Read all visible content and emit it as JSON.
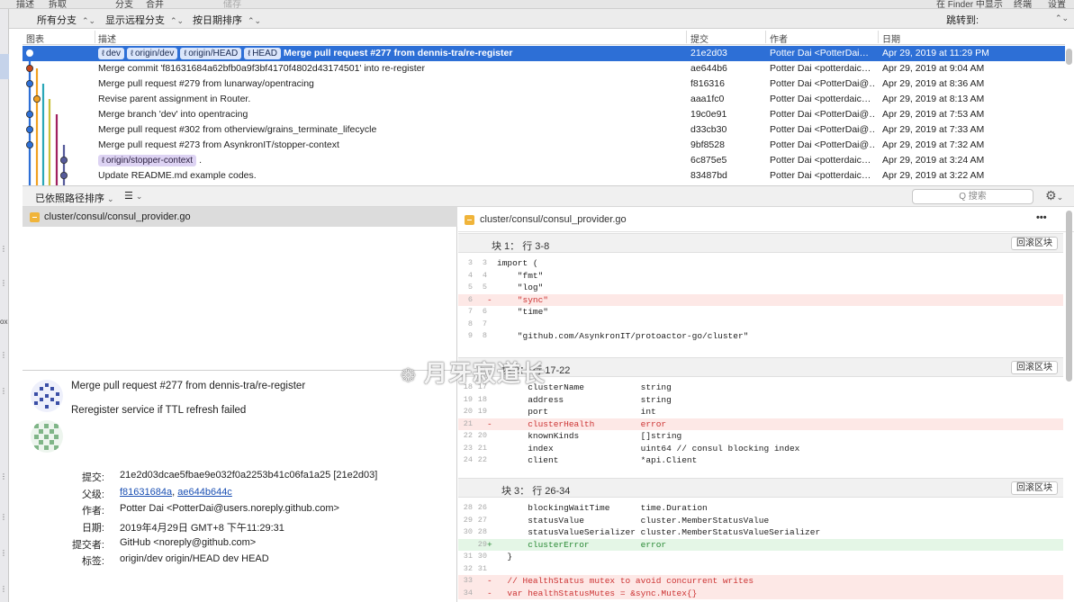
{
  "toolbar_fragments": [
    "描述",
    "拆取",
    "分支",
    "合并",
    "储存",
    "在 Finder 中显示",
    "终端",
    "设置"
  ],
  "filterbar": {
    "all_branches": "所有分支",
    "show_remote": "显示远程分支",
    "sort_by_date": "按日期排序",
    "jump_to": "跳转到:"
  },
  "sidebar_fragments": [
    "ox"
  ],
  "commit_list": {
    "headers": {
      "graph": "图表",
      "description": "描述",
      "commit": "提交",
      "author": "作者",
      "date": "日期"
    },
    "rows": [
      {
        "tags": [
          "dev",
          "origin/dev",
          "origin/HEAD",
          "HEAD"
        ],
        "message": "Merge pull request #277 from dennis-tra/re-register",
        "hash": "21e2d03",
        "author": "Potter Dai <PotterDai…",
        "date": "Apr 29, 2019 at 11:29 PM",
        "selected": true
      },
      {
        "tags": [],
        "message": "Merge commit 'f81631684a62bfb0a9f3bf4170f4802d43174501' into re-register",
        "hash": "ae644b6",
        "author": "Potter Dai <potterdaic…",
        "date": "Apr 29, 2019 at 9:04 AM"
      },
      {
        "tags": [],
        "message": "Merge pull request #279 from lunarway/opentracing",
        "hash": "f816316",
        "author": "Potter Dai <PotterDai@…",
        "date": "Apr 29, 2019 at 8:36 AM"
      },
      {
        "tags": [],
        "message": "Revise parent assignment in Router.",
        "hash": "aaa1fc0",
        "author": "Potter Dai <potterdaic…",
        "date": "Apr 29, 2019 at 8:13 AM"
      },
      {
        "tags": [],
        "message": "Merge branch 'dev' into opentracing",
        "hash": "19c0e91",
        "author": "Potter Dai <PotterDai@…",
        "date": "Apr 29, 2019 at 7:53 AM"
      },
      {
        "tags": [],
        "message": "Merge pull request #302 from otherview/grains_terminate_lifecycle",
        "hash": "d33cb30",
        "author": "Potter Dai <PotterDai@…",
        "date": "Apr 29, 2019 at 7:33 AM"
      },
      {
        "tags": [],
        "message": "Merge pull request #273 from AsynkronIT/stopper-context",
        "hash": "9bf8528",
        "author": "Potter Dai <PotterDai@…",
        "date": "Apr 29, 2019 at 7:32 AM"
      },
      {
        "tags": [
          "origin/stopper-context"
        ],
        "message": ".",
        "hash": "6c875e5",
        "author": "Potter Dai <potterdaic…",
        "date": "Apr 29, 2019 at 3:24 AM"
      },
      {
        "tags": [],
        "message": "Update README.md example codes.",
        "hash": "83487bd",
        "author": "Potter Dai <potterdaic…",
        "date": "Apr 29, 2019 at 3:22 AM"
      }
    ]
  },
  "lowerbar": {
    "sort_label": "已依照路径排序",
    "list_icon": "list-icon",
    "search_placeholder": "Q 搜索"
  },
  "file_list": {
    "items": [
      "cluster/consul/consul_provider.go"
    ]
  },
  "commit_details": {
    "title": "Merge pull request #277 from dennis-tra/re-register",
    "body": "Reregister service if TTL refresh failed",
    "fields": [
      {
        "label": "提交:",
        "value": "21e2d03dcae5fbae9e032f0a2253b41c06fa1a25 [21e2d03]"
      },
      {
        "label": "父级:",
        "links": [
          "f81631684a",
          "ae644b644c"
        ]
      },
      {
        "label": "作者:",
        "value": "Potter Dai <PotterDai@users.noreply.github.com>"
      },
      {
        "label": "日期:",
        "value": "2019年4月29日 GMT+8 下午11:29:31"
      },
      {
        "label": "提交者:",
        "value": "GitHub <noreply@github.com>"
      },
      {
        "label": "标签:",
        "value": "origin/dev origin/HEAD dev HEAD"
      }
    ]
  },
  "diff": {
    "file": "cluster/consul/consul_provider.go",
    "more_label": "•••",
    "revert_label": "回滚区块",
    "hunks": [
      {
        "title": "块 1：  行 3-8",
        "lines": [
          {
            "o": "3",
            "n": "3",
            "t": "ctx",
            "c": "import ("
          },
          {
            "o": "4",
            "n": "4",
            "t": "ctx",
            "c": "    \"fmt\""
          },
          {
            "o": "5",
            "n": "5",
            "t": "ctx",
            "c": "    \"log\""
          },
          {
            "o": "6",
            "n": "",
            "t": "del",
            "c": "    \"sync\""
          },
          {
            "o": "7",
            "n": "6",
            "t": "ctx",
            "c": "    \"time\""
          },
          {
            "o": "8",
            "n": "7",
            "t": "ctx",
            "c": ""
          },
          {
            "o": "9",
            "n": "8",
            "t": "ctx",
            "c": "    \"github.com/AsynkronIT/protoactor-go/cluster\""
          }
        ]
      },
      {
        "title": "块 2：  行 17-22",
        "lines": [
          {
            "o": "18",
            "n": "17",
            "t": "ctx",
            "c": "      clusterName           string"
          },
          {
            "o": "19",
            "n": "18",
            "t": "ctx",
            "c": "      address               string"
          },
          {
            "o": "20",
            "n": "19",
            "t": "ctx",
            "c": "      port                  int"
          },
          {
            "o": "21",
            "n": "",
            "t": "del",
            "c": "      clusterHealth         error"
          },
          {
            "o": "22",
            "n": "20",
            "t": "ctx",
            "c": "      knownKinds            []string"
          },
          {
            "o": "23",
            "n": "21",
            "t": "ctx",
            "c": "      index                 uint64 // consul blocking index"
          },
          {
            "o": "24",
            "n": "22",
            "t": "ctx",
            "c": "      client                *api.Client"
          }
        ]
      },
      {
        "title": "块 3：  行 26-34",
        "lines": [
          {
            "o": "28",
            "n": "26",
            "t": "ctx",
            "c": "      blockingWaitTime      time.Duration"
          },
          {
            "o": "29",
            "n": "27",
            "t": "ctx",
            "c": "      statusValue           cluster.MemberStatusValue"
          },
          {
            "o": "30",
            "n": "28",
            "t": "ctx",
            "c": "      statusValueSerializer cluster.MemberStatusValueSerializer"
          },
          {
            "o": "",
            "n": "29",
            "t": "add",
            "c": "      clusterError          error"
          },
          {
            "o": "31",
            "n": "30",
            "t": "ctx",
            "c": "  }"
          },
          {
            "o": "32",
            "n": "31",
            "t": "ctx",
            "c": ""
          },
          {
            "o": "33",
            "n": "",
            "t": "del",
            "c": "  // HealthStatus mutex to avoid concurrent writes"
          },
          {
            "o": "34",
            "n": "",
            "t": "del",
            "c": "  var healthStatusMutes = &sync.Mutex{}"
          }
        ]
      }
    ]
  },
  "watermark": "月牙寂道长",
  "colors": {
    "selection": "#2d6fd6",
    "tag": "#c9d9f4",
    "deleted": "#fde8e6",
    "added": "#e4f6e6"
  }
}
